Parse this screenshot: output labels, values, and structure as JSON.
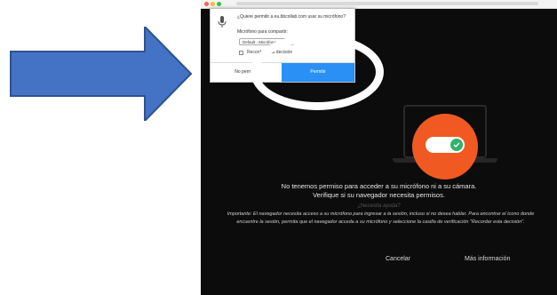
{
  "popup": {
    "message": "¿Quiere permitir a eu.bbcollab.com usar su micrófono?",
    "microphone_label": "Micrófono para compartir:",
    "device_value": "Default - Micrófono",
    "remember_label": "Recordar esta decisión",
    "deny_label": "No permitir",
    "allow_label": "Permitir"
  },
  "panel": {
    "title": "No tenemos permiso para acceder a su micrófono ni a su cámara.",
    "subtitle": "Verifique si su navegador necesita permisos.",
    "faint": "¿Necesita ayuda?",
    "important": "Importante: El navegador necesita acceso a su micrófono para ingresar a la sesión, incluso si no desea hablar. Para encontrar el ícono donde encuentre la sesión, permita que el navegador acceda a su micrófono y seleccione la casilla de verificación \"Recordar esta decisión\".",
    "cancel_label": "Cancelar",
    "more_label": "Más información"
  },
  "colors": {
    "allow_button": "#2a90f5",
    "accent_circle": "#f05a22",
    "toggle_knob": "#2fb26a",
    "background": "#0c0c0c",
    "arrow": "#4472c4"
  },
  "icons": [
    "microphone-icon",
    "checkmark-icon",
    "arrow-annotation"
  ]
}
